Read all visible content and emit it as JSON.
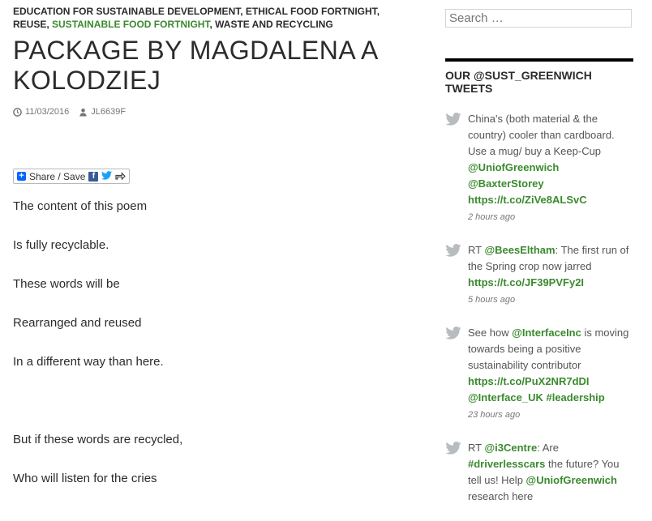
{
  "post": {
    "categories": [
      {
        "label": "EDUCATION FOR SUSTAINABLE DEVELOPMENT",
        "accent": false
      },
      {
        "label": "ETHICAL FOOD FORTNIGHT",
        "accent": false
      },
      {
        "label": "REUSE",
        "accent": false
      },
      {
        "label": "SUSTAINABLE FOOD FORTNIGHT",
        "accent": true
      },
      {
        "label": "WASTE AND RECYCLING",
        "accent": false
      }
    ],
    "title": "PACKAGE BY MAGDALENA A KOLODZIEJ",
    "date": "11/03/2016",
    "author": "JL6639F",
    "share_label": "Share / Save",
    "poem": [
      "The content of this poem",
      "Is fully recyclable.",
      "These words will be",
      "Rearranged and reused",
      "In a different way than here.",
      "But if these words are recycled,",
      "Who will listen for the cries"
    ]
  },
  "sidebar": {
    "search_placeholder": "Search …",
    "widget_title": "OUR @SUST_GREENWICH TWEETS",
    "tweets": [
      {
        "text": "China's (both material & the country) cooler than cardboard. Use a mug/ buy a Keep-Cup",
        "links": [
          "@UniofGreenwich",
          "@BaxterStorey",
          "https://t.co/ZiVe8ALSvC"
        ],
        "time": "2 hours ago"
      },
      {
        "prefix": "RT ",
        "mention": "@BeesEltham",
        "text": ": The first run of the Spring crop now jarred",
        "links": [
          "https://t.co/JF39PVFy2I"
        ],
        "time": "5 hours ago"
      },
      {
        "prefix": "See how ",
        "mention": "@InterfaceInc",
        "text": " is moving towards being a positive sustainability contributor",
        "links": [
          "https://t.co/PuX2NR7dDI",
          "@Interface_UK #leadership"
        ],
        "time": "23 hours ago"
      },
      {
        "prefix": "RT ",
        "mention": "@i3Centre",
        "text": ": Are",
        "mention2": "#driverlesscars",
        "text2": " the future? You tell us! Help ",
        "mention3": "@UniofGreenwich",
        "text3": " research here"
      }
    ]
  },
  "colors": {
    "accent": "#3a8a2e",
    "text": "#2b2b2b",
    "muted": "#767676"
  }
}
